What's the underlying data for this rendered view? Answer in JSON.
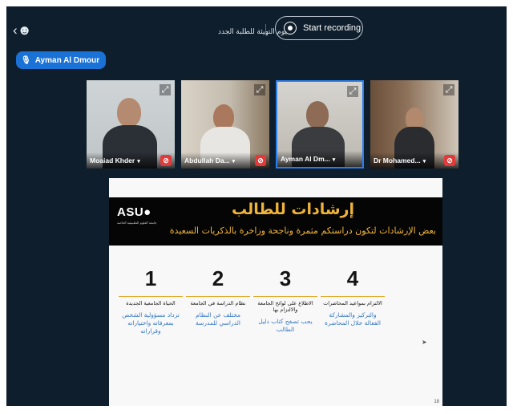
{
  "topbar": {
    "people_icon": "people-settings-icon",
    "meeting_title": "يوم التهيئة للطلبة الجدد",
    "record_label": "Start recording"
  },
  "active_speaker": {
    "name": "Ayman Al Dmour",
    "icon": "mic-icon"
  },
  "participants": [
    {
      "name": "Moaiad Khder",
      "muted": true
    },
    {
      "name": "Abdullah Da...",
      "muted": true
    },
    {
      "name": "Ayman Al Dm...",
      "muted": false,
      "active": true
    },
    {
      "name": "Dr Mohamed...",
      "muted": true
    }
  ],
  "slide": {
    "logo": "ASU",
    "logo_small": "جامعة العلوم التطبيقية الخاصة",
    "title": "إرشادات للطالب",
    "subtitle": "بعض الإرشادات لتكون دراستكم مثمرة وناجحة وزاخرة بالذكريات السعيدة",
    "steps": [
      {
        "num": "1",
        "head": "الحياة الجامعية الجديدة",
        "body": "تزداد مسؤولية الشخص بمعرفاته واختياراته وقراراته"
      },
      {
        "num": "2",
        "head": "نظام الدراسة في الجامعة",
        "body": "مختلف عن النظام الدراسي للمدرسة"
      },
      {
        "num": "3",
        "head": "الاطلاع على لوائح الجامعة والالتزام بها",
        "body": "يجب تصفح كتاب دليل الطالب"
      },
      {
        "num": "4",
        "head": "الالتزام بمواعيد المحاضرات",
        "body": "والتركيز والمشاركة الفعالة خلال المحاضرة"
      }
    ],
    "page_number": "18"
  },
  "colors": {
    "app_bg": "#0f1e2c",
    "accent": "#1b72d6",
    "slide_gold": "#f0b43a",
    "mute_red": "#e23a3a"
  }
}
